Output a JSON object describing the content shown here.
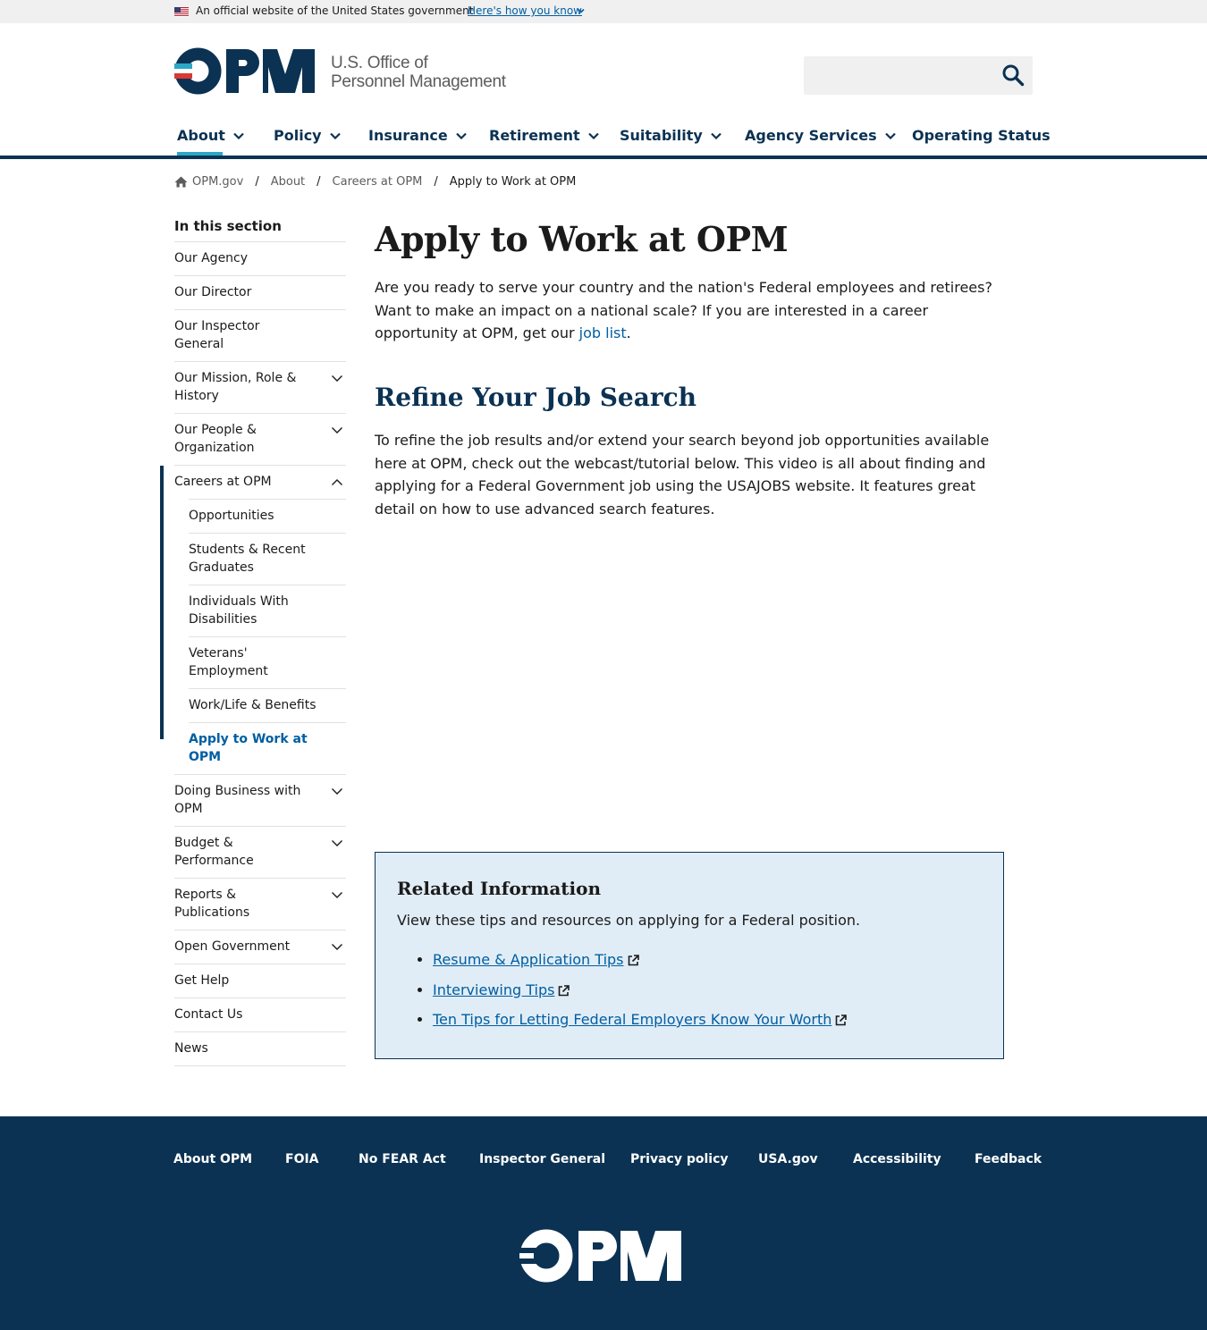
{
  "gov_banner": {
    "official_text": "An official website of the United States government",
    "how_link": "Here's how you know"
  },
  "header": {
    "logo_line1": "U.S. Office of",
    "logo_line2": "Personnel Management",
    "search_placeholder": ""
  },
  "nav": {
    "items": [
      {
        "label": "About"
      },
      {
        "label": "Policy"
      },
      {
        "label": "Insurance"
      },
      {
        "label": "Retirement"
      },
      {
        "label": "Suitability"
      },
      {
        "label": "Agency Services"
      },
      {
        "label": "Operating Status"
      }
    ]
  },
  "breadcrumb": {
    "items": [
      "OPM.gov",
      "About",
      "Careers at OPM"
    ],
    "current": "Apply to Work at OPM",
    "separator": "/"
  },
  "sidenav": {
    "title": "In this section",
    "items": [
      {
        "label": "Our Agency"
      },
      {
        "label": "Our Director"
      },
      {
        "label": "Our Inspector General"
      },
      {
        "label": "Our Mission, Role & History"
      },
      {
        "label": "Our People & Organization"
      },
      {
        "label": "Careers at OPM"
      },
      {
        "label": "Doing Business with OPM"
      },
      {
        "label": "Budget & Performance"
      },
      {
        "label": "Reports & Publications"
      },
      {
        "label": "Open Government"
      },
      {
        "label": "Get Help"
      },
      {
        "label": "Contact Us"
      },
      {
        "label": "News"
      }
    ],
    "sub_items": [
      {
        "label": "Opportunities"
      },
      {
        "label": "Students & Recent Graduates"
      },
      {
        "label": "Individuals With Disabilities"
      },
      {
        "label": "Veterans' Employment"
      },
      {
        "label": "Work/Life & Benefits"
      },
      {
        "label": "Apply to Work at OPM"
      }
    ]
  },
  "main": {
    "title": "Apply to Work at OPM",
    "intro_before": "Are you ready to serve your country and the nation's Federal employees and retirees? Want to make an impact on a national scale? If you are interested in a career opportunity at OPM, get our ",
    "intro_link": "job list",
    "intro_after": ".",
    "subtitle": "Refine Your Job Search",
    "body": "To refine the job results and/or extend your search beyond job opportunities available here at OPM, check out the webcast/tutorial below. This video is all about finding and applying for a Federal Government job using the USAJOBS website. It features great detail on how to use advanced search features."
  },
  "related": {
    "title": "Related Information",
    "description": "View these tips and resources on applying for a Federal position.",
    "links": [
      {
        "label": "Resume & Application Tips"
      },
      {
        "label": "Interviewing Tips"
      },
      {
        "label": "Ten Tips for Letting Federal Employers Know Your Worth"
      }
    ]
  },
  "footer": {
    "links": [
      "About OPM",
      "FOIA",
      "No FEAR Act",
      "Inspector General",
      "Privacy policy",
      "USA.gov",
      "Accessibility",
      "Feedback"
    ]
  },
  "colors": {
    "navy": "#0b3253",
    "link_blue": "#005ea2",
    "accent_teal": "#2ba8c7",
    "logo_red": "#d83933",
    "related_bg": "#e1edf6"
  },
  "icons": {
    "flag": "us-flag-icon",
    "search": "search-icon",
    "chevron": "chevron-down-icon",
    "home": "home-icon",
    "external": "external-link-icon"
  }
}
